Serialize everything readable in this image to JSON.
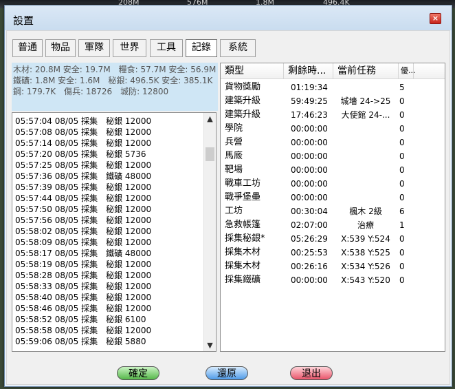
{
  "background": {
    "strip_values": [
      "208M",
      "576M",
      "1.8M",
      "496.4K"
    ]
  },
  "window": {
    "title": "設置",
    "close_label": "×"
  },
  "tabs": [
    {
      "label": "普通"
    },
    {
      "label": "物品"
    },
    {
      "label": "軍隊"
    },
    {
      "label": "世界"
    },
    {
      "label": "工具"
    },
    {
      "label": "記錄",
      "active": true
    },
    {
      "label": "系統"
    }
  ],
  "resources_text": "木材: 20.8M 安全: 19.7M　糧食: 57.7M 安全: 56.9M　鐵礦: 1.8M 安全: 1.6M　秘銀: 496.5K 安全: 385.1K　鋼: 179.7K　傷兵: 18726　城防: 12800",
  "log": {
    "entries": [
      "05:57:04 08/05 採集　秘銀 12000",
      "05:57:08 08/05 採集　秘銀 12000",
      "05:57:14 08/05 採集　秘銀 12000",
      "05:57:20 08/05 採集　秘銀 5736",
      "05:57:25 08/05 採集　秘銀 12000",
      "05:57:36 08/05 採集　鐵礦 48000",
      "05:57:39 08/05 採集　秘銀 12000",
      "05:57:44 08/05 採集　秘銀 12000",
      "05:57:50 08/05 採集　秘銀 12000",
      "05:57:56 08/05 採集　秘銀 12000",
      "05:58:02 08/05 採集　秘銀 12000",
      "05:58:09 08/05 採集　秘銀 12000",
      "05:58:17 08/05 採集　鐵礦 48000",
      "05:58:19 08/05 採集　秘銀 12000",
      "05:58:28 08/05 採集　秘銀 12000",
      "05:58:33 08/05 採集　秘銀 12000",
      "05:58:40 08/05 採集　秘銀 12000",
      "05:58:46 08/05 採集　秘銀 12000",
      "05:58:52 08/05 採集　秘銀 6100",
      "05:58:58 08/05 採集　秘銀 12000",
      "05:59:06 08/05 採集　秘銀 5880"
    ],
    "scroll_up_icon": "▲",
    "scroll_down_icon": "▼"
  },
  "queue": {
    "columns": [
      "類型",
      "剩餘時...",
      "當前任務",
      "優..."
    ],
    "rows": [
      {
        "type": "貨物獎勵",
        "time": "01:19:34",
        "task": "",
        "priority": "5"
      },
      {
        "type": "建築升級",
        "time": "59:49:25",
        "task": "城墻 24->25",
        "priority": "0"
      },
      {
        "type": "建築升級",
        "time": "17:46:23",
        "task": "大使館 24-...",
        "priority": "0"
      },
      {
        "type": "學院",
        "time": "00:00:00",
        "task": "",
        "priority": "0"
      },
      {
        "type": "兵營",
        "time": "00:00:00",
        "task": "",
        "priority": "0"
      },
      {
        "type": "馬廄",
        "time": "00:00:00",
        "task": "",
        "priority": "0"
      },
      {
        "type": "靶場",
        "time": "00:00:00",
        "task": "",
        "priority": "0"
      },
      {
        "type": "戰車工坊",
        "time": "00:00:00",
        "task": "",
        "priority": "0"
      },
      {
        "type": "戰爭堡壘",
        "time": "00:00:00",
        "task": "",
        "priority": "0"
      },
      {
        "type": "工坊",
        "time": "00:30:04",
        "task": "楓木 2級",
        "priority": "6"
      },
      {
        "type": "急救帳篷",
        "time": "02:07:00",
        "task": "治療",
        "priority": "1"
      },
      {
        "type": "採集秘銀*",
        "time": "05:26:29",
        "task": "X:539 Y:524",
        "priority": "0"
      },
      {
        "type": "採集木材",
        "time": "00:25:53",
        "task": "X:538 Y:525",
        "priority": "0"
      },
      {
        "type": "採集木材",
        "time": "00:26:16",
        "task": "X:534 Y:526",
        "priority": "0"
      },
      {
        "type": "採集鐵礦",
        "time": "00:00:00",
        "task": "X:543 Y:520",
        "priority": "0"
      }
    ]
  },
  "buttons": {
    "confirm": "確定",
    "restore": "還原",
    "exit": "退出"
  }
}
